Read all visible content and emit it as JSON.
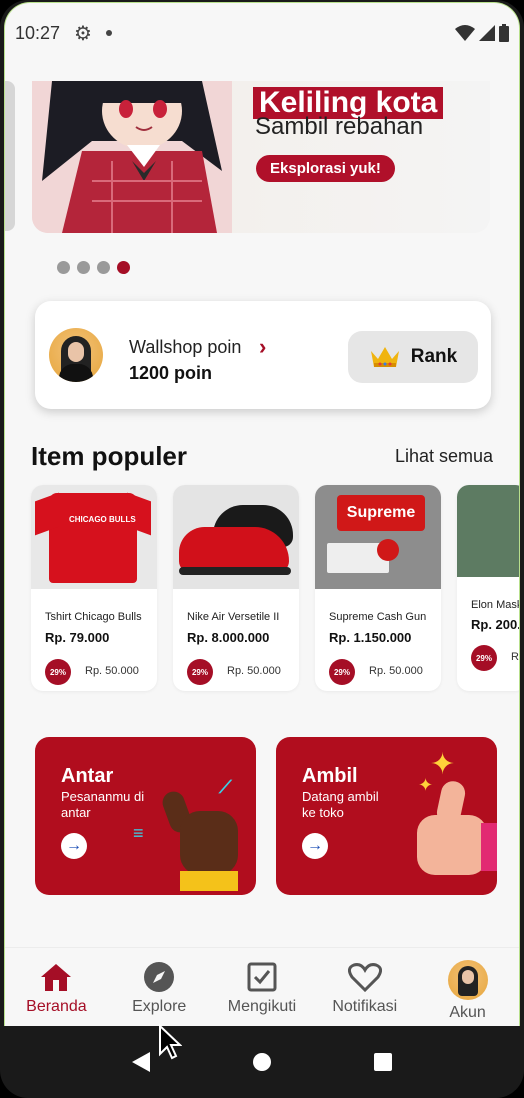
{
  "status": {
    "time": "10:27"
  },
  "banner": {
    "title": "Keliling kota",
    "subtitle": "Sambil rebahan",
    "cta": "Eksplorasi yuk!",
    "dots_total": 4,
    "dots_active": 4
  },
  "points": {
    "label": "Wallshop poin",
    "value": "1200 poin",
    "rank_label": "Rank"
  },
  "popular": {
    "title": "Item populer",
    "see_all": "Lihat semua",
    "items": [
      {
        "name": "Tshirt Chicago Bulls",
        "price": "Rp. 79.000",
        "discount": "29%",
        "old_price": "Rp. 50.000"
      },
      {
        "name": "Nike Air Versetile II",
        "price": "Rp. 8.000.000",
        "discount": "29%",
        "old_price": "Rp. 50.000"
      },
      {
        "name": "Supreme Cash Gun",
        "price": "Rp. 1.150.000",
        "discount": "29%",
        "old_price": "Rp. 50.000"
      },
      {
        "name": "Elon Mask",
        "price": "Rp. 200.",
        "discount": "29%",
        "old_price": "Rp"
      }
    ]
  },
  "services": [
    {
      "title": "Antar",
      "desc": "Pesananmu di antar"
    },
    {
      "title": "Ambil",
      "desc": "Datang ambil ke toko"
    }
  ],
  "nav": {
    "items": [
      {
        "label": "Beranda"
      },
      {
        "label": "Explore"
      },
      {
        "label": "Mengikuti"
      },
      {
        "label": "Notifikasi"
      },
      {
        "label": "Akun"
      }
    ],
    "active": "Beranda"
  },
  "colors": {
    "brand": "#a50e26",
    "accent": "#f0b40e"
  },
  "product_texts": {
    "chicago": "CHICAGO BULLS",
    "supreme": "Supreme"
  }
}
